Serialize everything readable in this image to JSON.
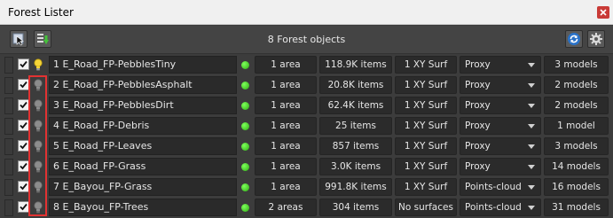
{
  "window": {
    "title": "Forest Lister"
  },
  "toolbar": {
    "heading": "8 Forest objects"
  },
  "colors": {
    "status_ok": "#3fcf1f",
    "highlight": "#e23232",
    "bulb_on": "#f5d438"
  },
  "rows": [
    {
      "name": "1 E_Road_FP-PebblesTiny",
      "areas": "1 area",
      "items": "118.9K items",
      "surface": "1 XY Surf",
      "mode": "Proxy",
      "models": "3 models",
      "bulb": "on"
    },
    {
      "name": "2 E_Road_FP-PebblesAsphalt",
      "areas": "1 area",
      "items": "20.8K items",
      "surface": "1 XY Surf",
      "mode": "Proxy",
      "models": "2 models",
      "bulb": "off"
    },
    {
      "name": "3 E_Road_FP-PebblesDirt",
      "areas": "1 area",
      "items": "62.4K items",
      "surface": "1 XY Surf",
      "mode": "Proxy",
      "models": "2 models",
      "bulb": "off"
    },
    {
      "name": "4 E_Road_FP-Debris",
      "areas": "1 area",
      "items": "25 items",
      "surface": "1 XY Surf",
      "mode": "Proxy",
      "models": "1 model",
      "bulb": "off"
    },
    {
      "name": "5 E_Road_FP-Leaves",
      "areas": "1 area",
      "items": "857 items",
      "surface": "1 XY Surf",
      "mode": "Proxy",
      "models": "3 models",
      "bulb": "off"
    },
    {
      "name": "6 E_Road_FP-Grass",
      "areas": "1 area",
      "items": "3.0K items",
      "surface": "1 XY Surf",
      "mode": "Proxy",
      "models": "14 models",
      "bulb": "off"
    },
    {
      "name": "7 E_Bayou_FP-Grass",
      "areas": "1 area",
      "items": "991.8K items",
      "surface": "1 XY Surf",
      "mode": "Points-cloud",
      "models": "16 models",
      "bulb": "off"
    },
    {
      "name": "8 E_Bayou_FP-Trees",
      "areas": "2 areas",
      "items": "304 items",
      "surface": "No surfaces",
      "mode": "Points-cloud",
      "models": "31 models",
      "bulb": "off"
    }
  ]
}
